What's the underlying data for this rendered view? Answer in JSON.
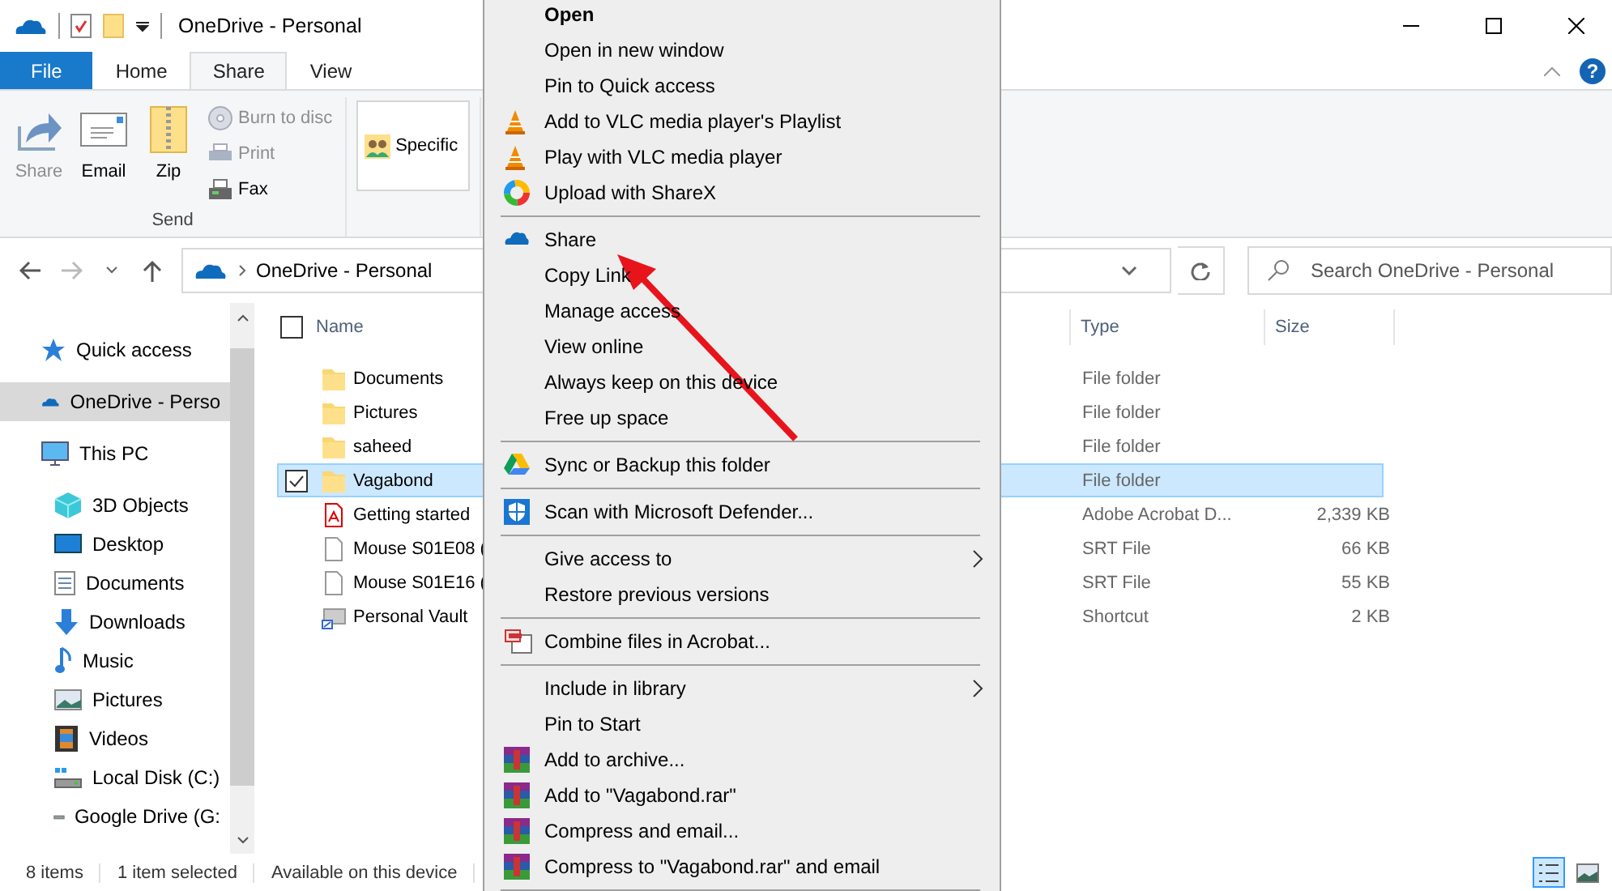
{
  "window": {
    "title": "OneDrive - Personal"
  },
  "ribbon_tabs": [
    {
      "label": "File",
      "selected": false,
      "kind": "file"
    },
    {
      "label": "Home",
      "selected": false,
      "kind": "tab"
    },
    {
      "label": "Share",
      "selected": true,
      "kind": "tab"
    },
    {
      "label": "View",
      "selected": false,
      "kind": "tab"
    }
  ],
  "ribbon": {
    "send_group": {
      "label": "Send",
      "large_buttons": [
        {
          "label": "Share",
          "disabled": true
        },
        {
          "label": "Email",
          "disabled": false
        },
        {
          "label": "Zip",
          "disabled": false
        }
      ],
      "small_buttons": [
        {
          "label": "Burn to disc",
          "disabled": true
        },
        {
          "label": "Print",
          "disabled": true
        },
        {
          "label": "Fax",
          "disabled": false
        }
      ]
    },
    "share_with": {
      "button": "Specific"
    }
  },
  "help_button": "?",
  "address_bar": {
    "path": [
      "OneDrive - Personal"
    ]
  },
  "search": {
    "placeholder": "Search OneDrive - Personal"
  },
  "navigation_pane": [
    {
      "label": "Quick access",
      "selected": false
    },
    {
      "label": "OneDrive - Perso",
      "selected": true
    },
    {
      "label": "This PC",
      "selected": false,
      "children": [
        {
          "label": "3D Objects",
          "selected": false
        },
        {
          "label": "Desktop",
          "selected": false
        },
        {
          "label": "Documents",
          "selected": false
        },
        {
          "label": "Downloads",
          "selected": false
        },
        {
          "label": "Music",
          "selected": false
        },
        {
          "label": "Pictures",
          "selected": false
        },
        {
          "label": "Videos",
          "selected": false
        },
        {
          "label": "Local Disk (C:)",
          "selected": false
        },
        {
          "label": "Google Drive (G:",
          "selected": false
        }
      ]
    }
  ],
  "file_list": {
    "select_all": {
      "checked": false
    },
    "columns": [
      "Name",
      "Type",
      "Size"
    ],
    "rows": [
      {
        "name": "Documents",
        "type": "File folder",
        "size": "",
        "kind": "folder",
        "selected": false
      },
      {
        "name": "Pictures",
        "type": "File folder",
        "size": "",
        "kind": "folder",
        "selected": false
      },
      {
        "name": "saheed",
        "type": "File folder",
        "size": "",
        "kind": "folder",
        "selected": false
      },
      {
        "name": "Vagabond",
        "type": "File folder",
        "size": "",
        "kind": "folder",
        "selected": true
      },
      {
        "name": "Getting started",
        "type": "Adobe Acrobat D...",
        "size": "2,339 KB",
        "kind": "pdf",
        "selected": false
      },
      {
        "name": "Mouse S01E08 (",
        "type": "SRT File",
        "size": "66 KB",
        "kind": "file",
        "selected": false
      },
      {
        "name": "Mouse S01E16 (",
        "type": "SRT File",
        "size": "55 KB",
        "kind": "file",
        "selected": false
      },
      {
        "name": "Personal Vault",
        "type": "Shortcut",
        "size": "2 KB",
        "kind": "shortcut",
        "selected": false
      }
    ]
  },
  "status_bar": [
    "8 items",
    "1 item selected",
    "Available on this device"
  ],
  "context_menu": [
    [
      {
        "label": "Open",
        "default": true
      },
      {
        "label": "Open in new window"
      },
      {
        "label": "Pin to Quick access"
      },
      {
        "label": "Add to VLC media player's Playlist"
      },
      {
        "label": "Play with VLC media player"
      },
      {
        "label": "Upload with ShareX"
      }
    ],
    [
      {
        "label": "Share"
      },
      {
        "label": "Copy Link"
      },
      {
        "label": "Manage access"
      },
      {
        "label": "View online"
      },
      {
        "label": "Always keep on this device"
      },
      {
        "label": "Free up space"
      }
    ],
    [
      {
        "label": "Sync or Backup this folder"
      }
    ],
    [
      {
        "label": "Scan with Microsoft Defender..."
      }
    ],
    [
      {
        "label": "Give access to",
        "submenu": true
      },
      {
        "label": "Restore previous versions"
      }
    ],
    [
      {
        "label": "Combine files in Acrobat..."
      }
    ],
    [
      {
        "label": "Include in library",
        "submenu": true
      },
      {
        "label": "Pin to Start"
      },
      {
        "label": "Add to archive..."
      },
      {
        "label": "Add to \"Vagabond.rar\""
      },
      {
        "label": "Compress and email..."
      },
      {
        "label": "Compress to \"Vagabond.rar\" and email"
      }
    ]
  ]
}
